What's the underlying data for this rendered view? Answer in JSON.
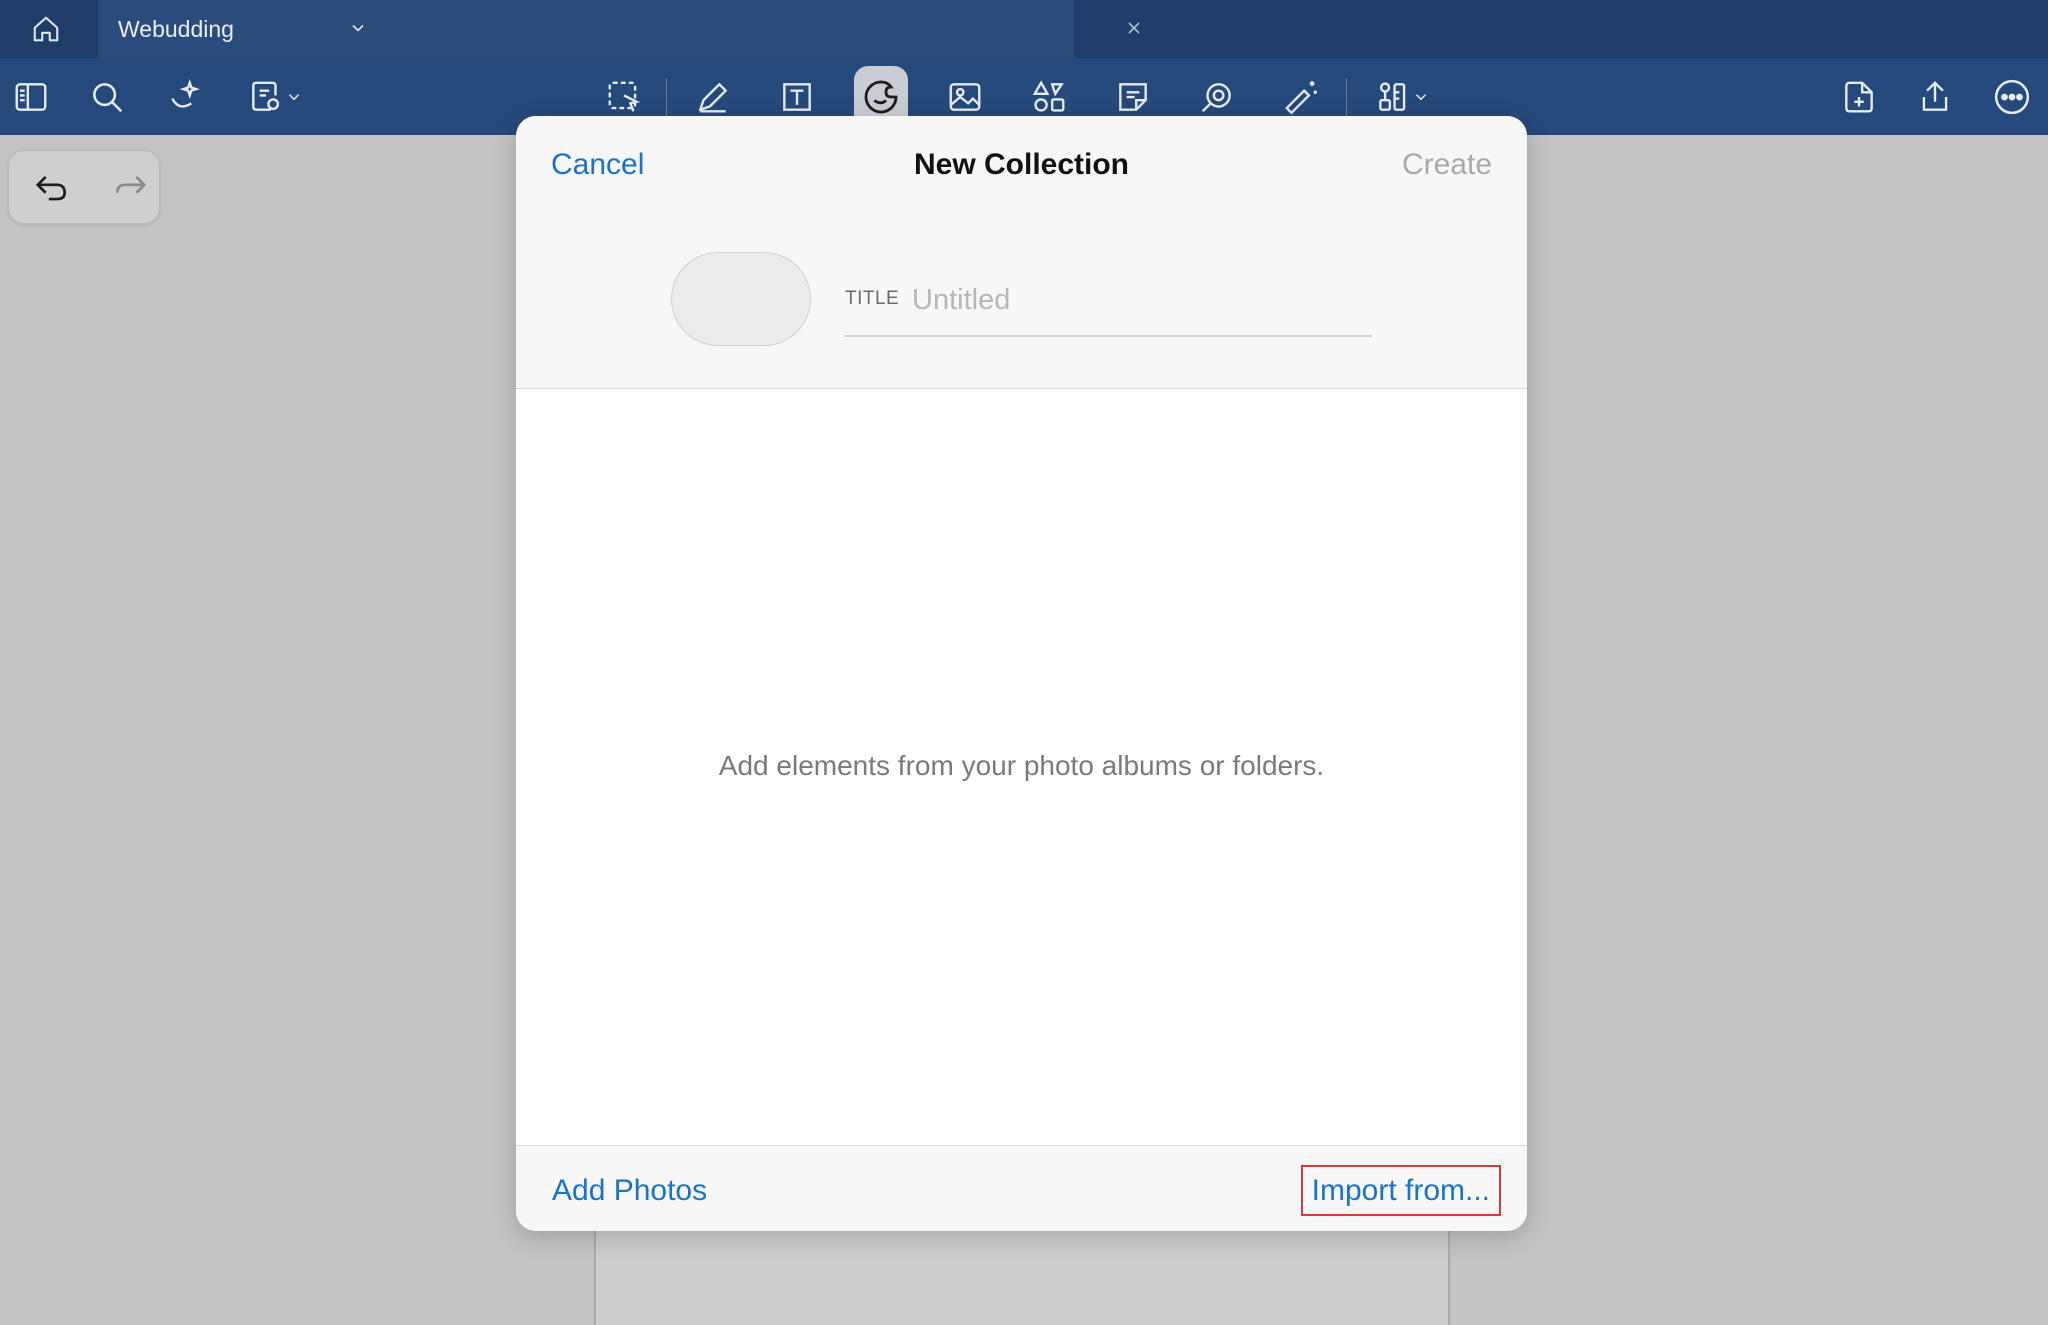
{
  "tab": {
    "title": "Webudding"
  },
  "dialog": {
    "cancel_label": "Cancel",
    "title": "New Collection",
    "create_label": "Create",
    "title_field_label": "TITLE",
    "title_placeholder": "Untitled",
    "title_value": "",
    "empty_message": "Add elements from your photo albums or folders.",
    "add_photos_label": "Add Photos",
    "import_label": "Import from..."
  },
  "toolbar": {
    "left_icons": [
      "sidebar-icon",
      "search-icon",
      "ai-sparkle-icon",
      "document-template-icon"
    ],
    "center_icons": [
      "lasso-select-icon",
      "pen-icon",
      "text-box-icon",
      "sticker-icon",
      "image-icon",
      "shapes-icon",
      "sticky-note-icon",
      "laser-pointer-icon",
      "magic-wand-icon",
      "more-tools-icon"
    ],
    "right_icons": [
      "add-page-icon",
      "share-icon",
      "more-icon"
    ],
    "active_tool": "sticker-icon"
  },
  "colors": {
    "tabbar": "#1f3d6b",
    "toolbar": "#26497b",
    "accent": "#1a73c9",
    "highlight_border": "#d63b3b",
    "disabled_text": "#a9a9a9"
  }
}
